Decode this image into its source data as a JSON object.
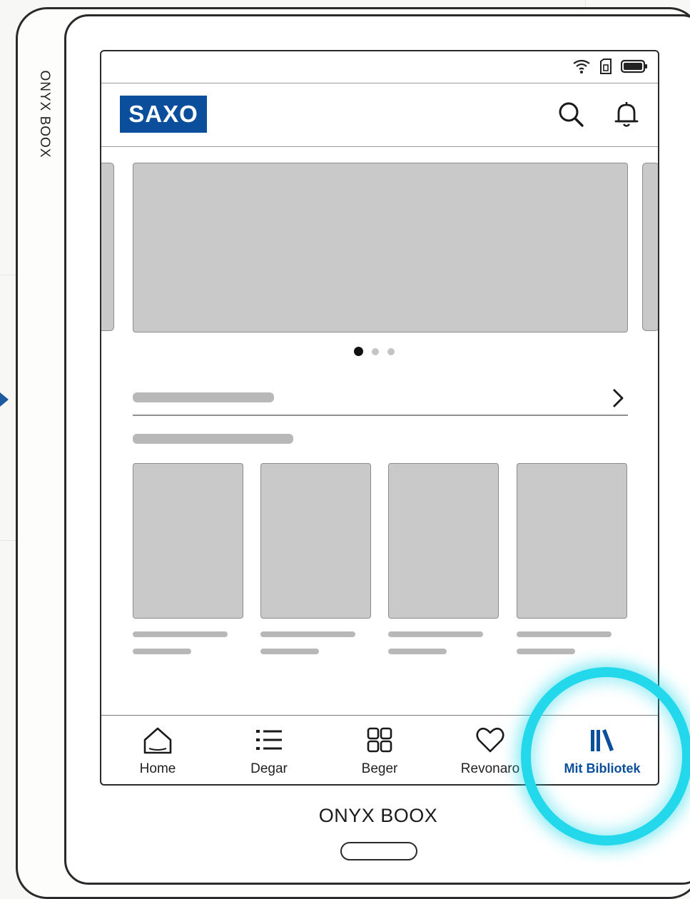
{
  "device": {
    "brand_label": "ONYX BOOX",
    "spine_label": "ONYX BOOX"
  },
  "status_bar": {
    "icons": [
      "wifi-icon",
      "sim-icon",
      "battery-icon"
    ]
  },
  "header": {
    "logo_text": "SAXO",
    "icons": [
      "search-icon",
      "bell-icon"
    ]
  },
  "carousel": {
    "page_count": 3,
    "active_index": 0
  },
  "section": {
    "icons": [
      "chevron-right-icon"
    ],
    "book_count": 4
  },
  "bottom_nav": {
    "active_index": 4,
    "items": [
      {
        "label": "Home",
        "icon": "home-icon"
      },
      {
        "label": "Degar",
        "icon": "list-icon"
      },
      {
        "label": "Beger",
        "icon": "grid-icon"
      },
      {
        "label": "Revonaro",
        "icon": "heart-icon"
      },
      {
        "label": "Mit Bibliotek",
        "icon": "library-icon"
      }
    ]
  },
  "colors": {
    "brand_blue": "#0b4f9c",
    "highlight_cyan": "#22d8ea",
    "placeholder_gray": "#c9c9c9"
  }
}
